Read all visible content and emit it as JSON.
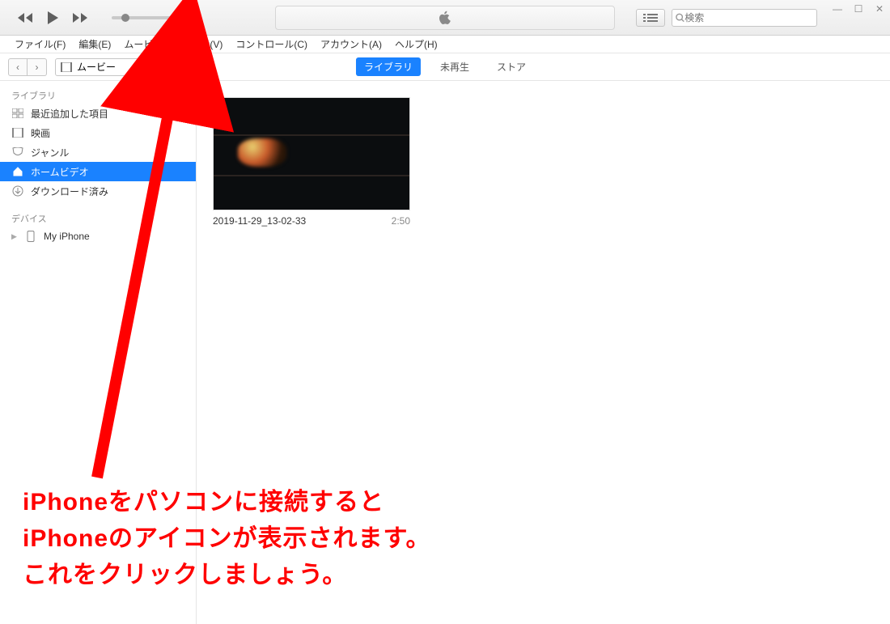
{
  "window": {
    "min": "—",
    "max": "☐",
    "close": "✕"
  },
  "search": {
    "placeholder": "検索"
  },
  "menubar": {
    "file": "ファイル(F)",
    "edit": "編集(E)",
    "movie": "ムービー(M)",
    "view": "表示(V)",
    "control": "コントロール(C)",
    "account": "アカウント(A)",
    "help": "ヘルプ(H)"
  },
  "toolbar2": {
    "media_label": "ムービー",
    "tab_library": "ライブラリ",
    "tab_unplayed": "未再生",
    "tab_store": "ストア"
  },
  "sidebar": {
    "section_library": "ライブラリ",
    "items": [
      {
        "label": "最近追加した項目"
      },
      {
        "label": "映画"
      },
      {
        "label": "ジャンル"
      },
      {
        "label": "ホームビデオ"
      },
      {
        "label": "ダウンロード済み"
      }
    ],
    "section_devices": "デバイス",
    "device_label": "My iPhone"
  },
  "video": {
    "title": "2019-11-29_13-02-33",
    "duration": "2:50"
  },
  "annotation": {
    "line1": "iPhoneをパソコンに接続すると",
    "line2": "iPhoneのアイコンが表示されます。",
    "line3": "これをクリックしましょう。"
  }
}
